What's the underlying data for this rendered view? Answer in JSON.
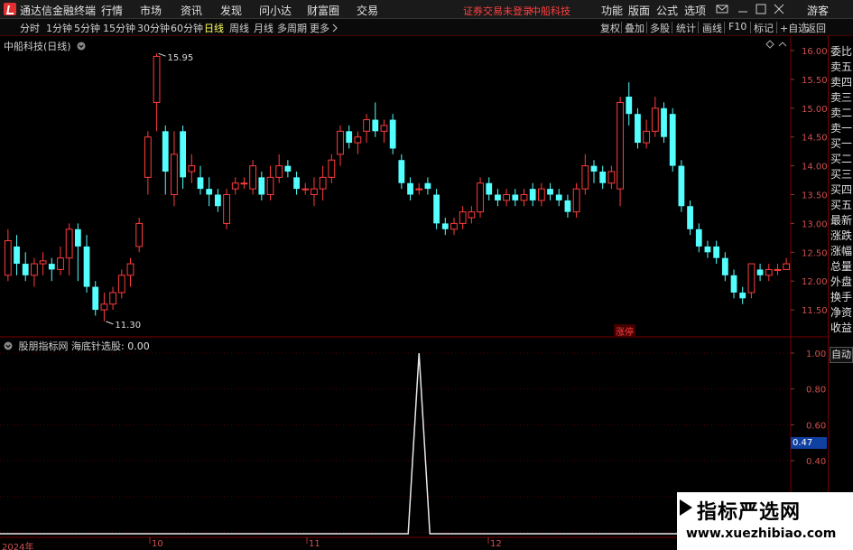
{
  "titlebar": {
    "app_title": "通达信金融终端",
    "menus": [
      "行情",
      "市场",
      "资讯",
      "发现",
      "问小达",
      "财富圈",
      "交易"
    ],
    "status_msg": "证券交易未登录",
    "stock_name": "中船科技",
    "right_menus": [
      "功能",
      "版面",
      "公式",
      "选项"
    ],
    "guest": "游客"
  },
  "toolbar": {
    "periods": [
      "分时",
      "1分钟",
      "5分钟",
      "15分钟",
      "30分钟",
      "60分钟",
      "日线",
      "周线",
      "月线",
      "多周期",
      "更多"
    ],
    "active_period": "日线",
    "right_buttons": [
      "复权",
      "叠加",
      "多股",
      "统计",
      "画线",
      "F10",
      "标记",
      "+自选",
      "返回"
    ]
  },
  "chart": {
    "title": "中船科技(日线)",
    "high_label": "15.95",
    "low_label": "11.30",
    "limit_up_label": "涨停",
    "y_ticks": [
      "16.00",
      "15.50",
      "15.00",
      "14.50",
      "14.00",
      "13.50",
      "13.00",
      "12.50",
      "12.00",
      "11.50"
    ]
  },
  "indicator": {
    "title": "股朋指标网  海底针选股:",
    "value": "0.00",
    "y_ticks": [
      "1.00",
      "0.80",
      "0.60",
      "0.40"
    ],
    "current_value": "0.47"
  },
  "x_axis": {
    "labels": [
      "2024年",
      "10",
      "11",
      "12"
    ]
  },
  "sidepanel": {
    "items": [
      "委比",
      "卖五",
      "卖四",
      "卖三",
      "卖二",
      "卖一",
      "买一",
      "买二",
      "买三",
      "买四",
      "买五",
      "最新",
      "涨跌",
      "涨幅",
      "总量",
      "外盘",
      "换手",
      "净资",
      "收益"
    ],
    "auto_label": "自动"
  },
  "watermark": {
    "line1": "指标严选网",
    "line2": "www.xuezhibiao.com"
  },
  "colors": {
    "up": "#ff3c3c",
    "down": "#54ffff",
    "axis": "#d05050"
  },
  "chart_data": {
    "type": "candlestick",
    "y_range": [
      11.3,
      16.2
    ],
    "candles": [
      [
        12.1,
        12.7,
        12.0,
        12.9
      ],
      [
        12.6,
        12.3,
        12.1,
        12.8
      ],
      [
        12.3,
        12.1,
        12.0,
        12.5
      ],
      [
        12.1,
        12.3,
        11.9,
        12.4
      ],
      [
        12.3,
        12.35,
        12.1,
        12.5
      ],
      [
        12.3,
        12.2,
        12.0,
        12.4
      ],
      [
        12.2,
        12.4,
        12.1,
        12.6
      ],
      [
        12.4,
        12.9,
        12.1,
        13.0
      ],
      [
        12.9,
        12.6,
        12.0,
        13.0
      ],
      [
        12.6,
        11.9,
        11.8,
        12.8
      ],
      [
        11.9,
        11.5,
        11.4,
        12.0
      ],
      [
        11.5,
        11.6,
        11.3,
        11.8
      ],
      [
        11.6,
        11.8,
        11.5,
        11.9
      ],
      [
        11.8,
        12.1,
        11.7,
        12.2
      ],
      [
        12.1,
        12.3,
        11.9,
        12.4
      ],
      [
        12.6,
        13.0,
        12.5,
        13.1
      ],
      [
        13.8,
        14.5,
        13.5,
        14.6
      ],
      [
        15.1,
        15.9,
        14.6,
        15.95
      ],
      [
        14.6,
        13.9,
        13.5,
        14.7
      ],
      [
        13.5,
        14.2,
        13.3,
        14.6
      ],
      [
        14.6,
        13.8,
        13.6,
        14.7
      ],
      [
        13.9,
        14.0,
        13.7,
        14.2
      ],
      [
        13.8,
        13.6,
        13.5,
        14.0
      ],
      [
        13.6,
        13.5,
        13.3,
        13.8
      ],
      [
        13.5,
        13.3,
        13.2,
        13.6
      ],
      [
        13.0,
        13.5,
        12.9,
        13.6
      ],
      [
        13.6,
        13.7,
        13.5,
        13.8
      ],
      [
        13.7,
        13.7,
        13.6,
        13.8
      ],
      [
        13.6,
        14.0,
        13.5,
        14.1
      ],
      [
        13.8,
        13.5,
        13.4,
        13.9
      ],
      [
        13.5,
        13.8,
        13.4,
        14.0
      ],
      [
        13.8,
        14.0,
        13.7,
        14.2
      ],
      [
        14.0,
        13.9,
        13.8,
        14.1
      ],
      [
        13.8,
        13.6,
        13.5,
        13.9
      ],
      [
        13.6,
        13.6,
        13.5,
        13.7
      ],
      [
        13.5,
        13.6,
        13.3,
        13.8
      ],
      [
        13.6,
        13.8,
        13.4,
        14.0
      ],
      [
        13.8,
        14.1,
        13.7,
        14.2
      ],
      [
        14.2,
        14.6,
        14.0,
        14.7
      ],
      [
        14.6,
        14.4,
        14.3,
        14.7
      ],
      [
        14.4,
        14.5,
        14.2,
        14.6
      ],
      [
        14.6,
        14.8,
        14.4,
        14.9
      ],
      [
        14.8,
        14.6,
        14.5,
        15.1
      ],
      [
        14.6,
        14.7,
        14.4,
        14.8
      ],
      [
        14.8,
        14.3,
        14.2,
        14.9
      ],
      [
        14.1,
        13.7,
        13.6,
        14.2
      ],
      [
        13.7,
        13.5,
        13.4,
        13.8
      ],
      [
        13.6,
        13.6,
        13.5,
        13.7
      ],
      [
        13.7,
        13.6,
        13.5,
        13.8
      ],
      [
        13.5,
        13.0,
        12.9,
        13.6
      ],
      [
        13.0,
        12.9,
        12.8,
        13.1
      ],
      [
        12.9,
        13.0,
        12.8,
        13.1
      ],
      [
        13.0,
        13.2,
        12.9,
        13.3
      ],
      [
        13.1,
        13.2,
        13.0,
        13.3
      ],
      [
        13.2,
        13.7,
        13.1,
        13.8
      ],
      [
        13.7,
        13.5,
        13.4,
        13.8
      ],
      [
        13.5,
        13.4,
        13.3,
        13.6
      ],
      [
        13.4,
        13.5,
        13.3,
        13.6
      ],
      [
        13.5,
        13.4,
        13.3,
        13.6
      ],
      [
        13.4,
        13.5,
        13.3,
        13.6
      ],
      [
        13.6,
        13.4,
        13.3,
        13.7
      ],
      [
        13.4,
        13.6,
        13.3,
        13.7
      ],
      [
        13.6,
        13.5,
        13.4,
        13.7
      ],
      [
        13.5,
        13.4,
        13.3,
        13.6
      ],
      [
        13.4,
        13.2,
        13.1,
        13.5
      ],
      [
        13.2,
        13.6,
        13.1,
        13.7
      ],
      [
        13.6,
        14.0,
        13.5,
        14.2
      ],
      [
        14.0,
        13.9,
        13.7,
        14.1
      ],
      [
        13.9,
        13.7,
        13.6,
        14.0
      ],
      [
        13.7,
        13.9,
        13.6,
        14.0
      ],
      [
        13.6,
        15.1,
        13.3,
        15.2
      ],
      [
        15.2,
        14.9,
        14.7,
        15.45
      ],
      [
        14.9,
        14.4,
        14.3,
        15.0
      ],
      [
        14.4,
        14.6,
        14.3,
        14.8
      ],
      [
        14.6,
        15.0,
        14.5,
        15.2
      ],
      [
        15.0,
        14.5,
        14.4,
        15.1
      ],
      [
        14.9,
        14.0,
        13.9,
        15.0
      ],
      [
        14.0,
        13.3,
        13.2,
        14.1
      ],
      [
        13.3,
        12.9,
        12.8,
        13.4
      ],
      [
        12.9,
        12.6,
        12.5,
        13.0
      ],
      [
        12.6,
        12.5,
        12.4,
        12.7
      ],
      [
        12.6,
        12.4,
        12.3,
        12.7
      ],
      [
        12.4,
        12.1,
        12.0,
        12.5
      ],
      [
        12.1,
        11.8,
        11.7,
        12.2
      ],
      [
        11.8,
        11.7,
        11.6,
        11.9
      ],
      [
        11.8,
        12.3,
        11.7,
        12.3
      ],
      [
        12.2,
        12.1,
        12.0,
        12.3
      ],
      [
        12.1,
        12.2,
        12.0,
        12.3
      ],
      [
        12.2,
        12.2,
        12.1,
        12.3
      ],
      [
        12.2,
        12.3,
        12.2,
        12.4
      ]
    ],
    "indicator_series": {
      "name": "海底针选股",
      "spike_index": 47,
      "spike_value": 1.0
    }
  }
}
